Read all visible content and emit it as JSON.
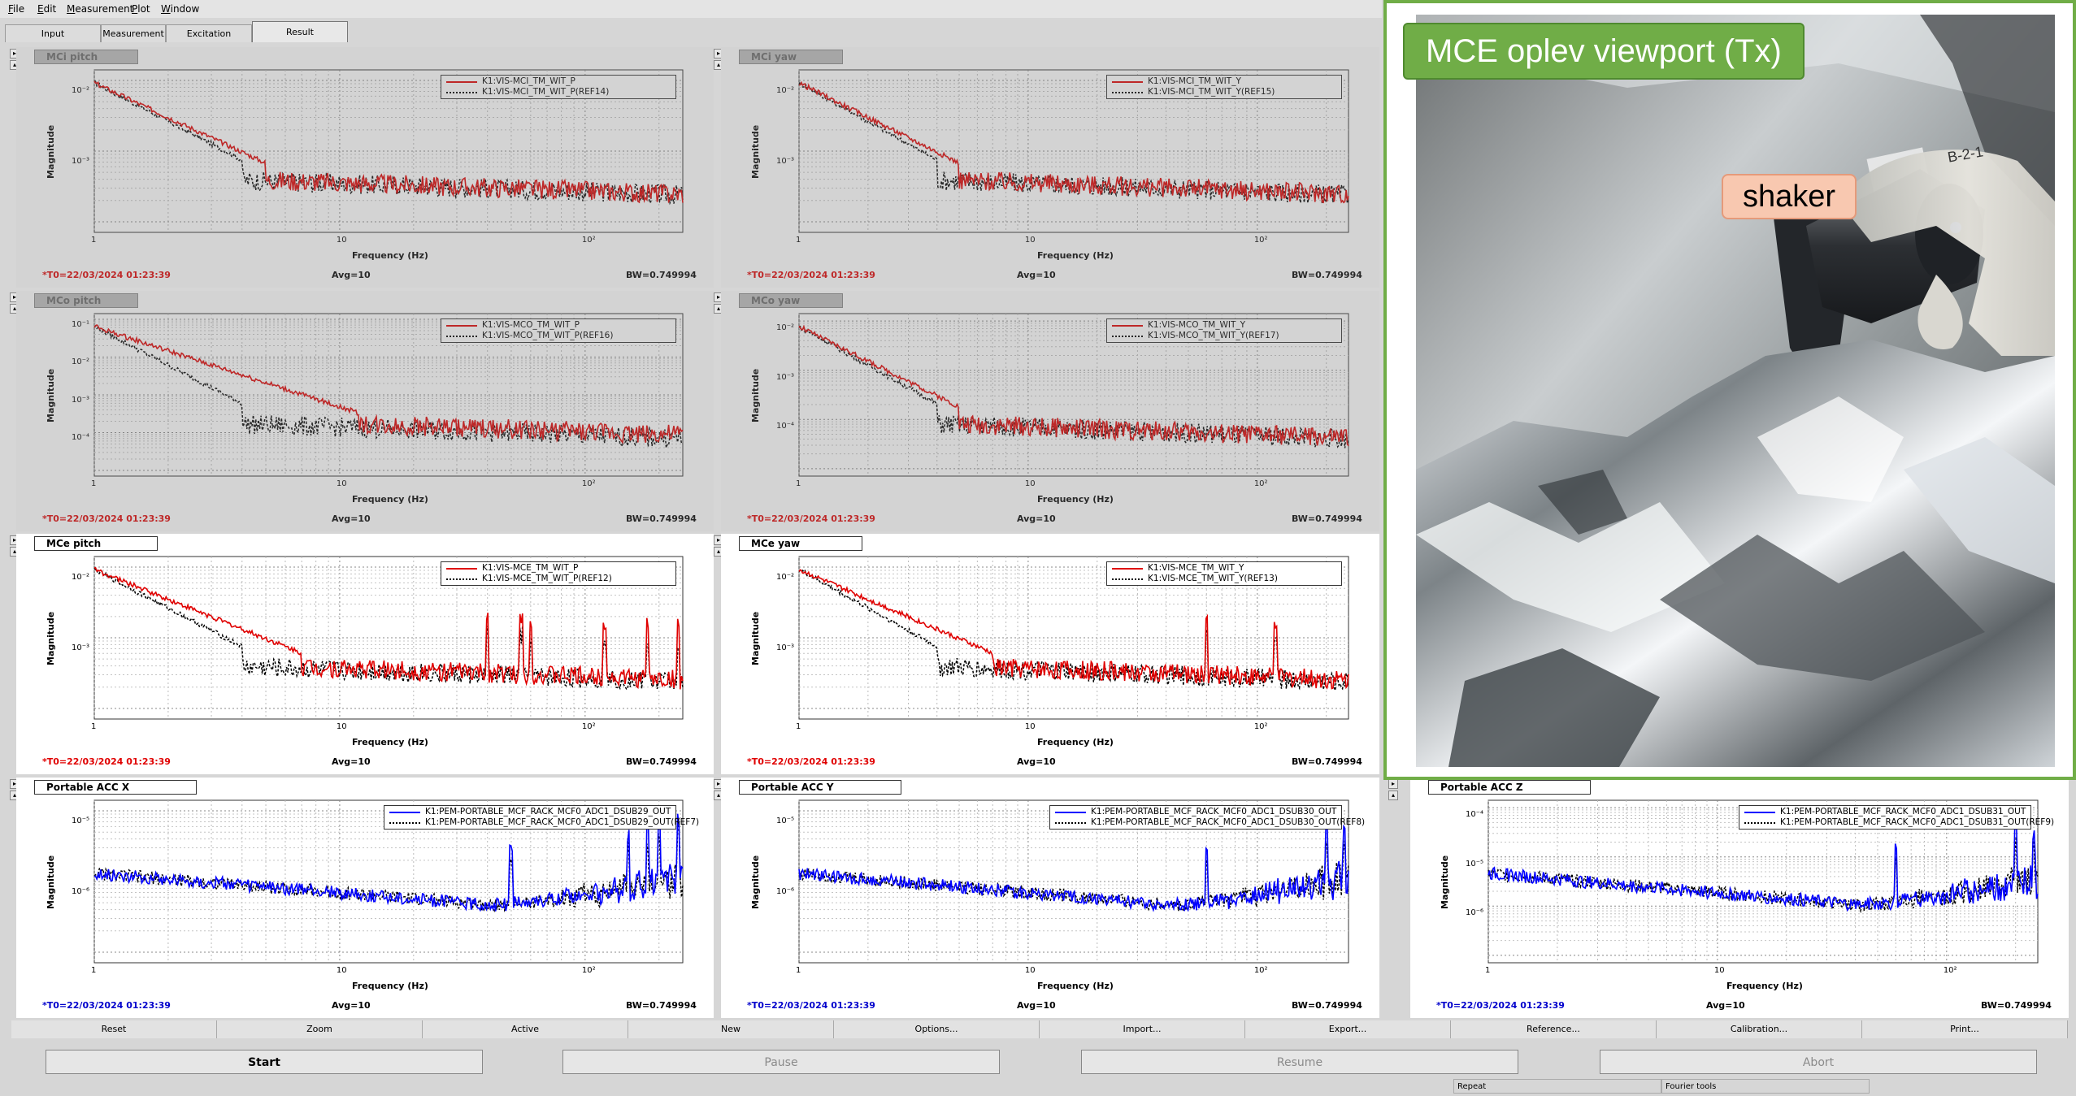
{
  "menubar": {
    "items": [
      {
        "label": "File",
        "hot": "F"
      },
      {
        "label": "Edit",
        "hot": "E"
      },
      {
        "label": "Measurement",
        "hot": "M"
      },
      {
        "label": "Plot",
        "hot": "P"
      },
      {
        "label": "Window",
        "hot": "W"
      }
    ]
  },
  "tabs": [
    "Input",
    "Measurement",
    "Excitation",
    "Result"
  ],
  "active_tab": "Result",
  "panels": [
    {
      "title": "MCi pitch",
      "dim": true,
      "color": "red",
      "legend": [
        "K1:VIS-MCI_TM_WIT_P",
        "K1:VIS-MCI_TM_WIT_P(REF14)"
      ],
      "yticks": [
        "10⁻²",
        "10⁻³"
      ],
      "xticks": [
        "1",
        "10",
        "10²"
      ],
      "xlabel": "Frequency (Hz)",
      "ylabel": "Magnitude",
      "t0": "*T0=22/03/2024 01:23:39",
      "avg": "Avg=10",
      "bw": "BW=0.749994"
    },
    {
      "title": "MCi yaw",
      "dim": true,
      "color": "red",
      "legend": [
        "K1:VIS-MCI_TM_WIT_Y",
        "K1:VIS-MCI_TM_WIT_Y(REF15)"
      ],
      "yticks": [
        "10⁻²",
        "10⁻³"
      ],
      "xticks": [
        "1",
        "10",
        "10²"
      ],
      "xlabel": "Frequency (Hz)",
      "ylabel": "Magnitude",
      "t0": "*T0=22/03/2024 01:23:39",
      "avg": "Avg=10",
      "bw": "BW=0.749994"
    },
    {
      "title": "MCo pitch",
      "dim": true,
      "color": "red",
      "legend": [
        "K1:VIS-MCO_TM_WIT_P",
        "K1:VIS-MCO_TM_WIT_P(REF16)"
      ],
      "yticks": [
        "10⁻¹",
        "10⁻²",
        "10⁻³",
        "10⁻⁴"
      ],
      "xticks": [
        "1",
        "10",
        "10²"
      ],
      "xlabel": "Frequency (Hz)",
      "ylabel": "Magnitude",
      "t0": "*T0=22/03/2024 01:23:39",
      "avg": "Avg=10",
      "bw": "BW=0.749994"
    },
    {
      "title": "MCo yaw",
      "dim": true,
      "color": "red",
      "legend": [
        "K1:VIS-MCO_TM_WIT_Y",
        "K1:VIS-MCO_TM_WIT_Y(REF17)"
      ],
      "yticks": [
        "10⁻²",
        "10⁻³",
        "10⁻⁴"
      ],
      "xticks": [
        "1",
        "10",
        "10²"
      ],
      "xlabel": "Frequency (Hz)",
      "ylabel": "Magnitude",
      "t0": "*T0=22/03/2024 01:23:39",
      "avg": "Avg=10",
      "bw": "BW=0.749994"
    },
    {
      "title": "MCe pitch",
      "dim": false,
      "color": "red",
      "legend": [
        "K1:VIS-MCE_TM_WIT_P",
        "K1:VIS-MCE_TM_WIT_P(REF12)"
      ],
      "yticks": [
        "10⁻²",
        "10⁻³"
      ],
      "xticks": [
        "1",
        "10",
        "10²"
      ],
      "xlabel": "Frequency (Hz)",
      "ylabel": "Magnitude",
      "t0": "*T0=22/03/2024 01:23:39",
      "avg": "Avg=10",
      "bw": "BW=0.749994"
    },
    {
      "title": "MCe yaw",
      "dim": false,
      "color": "red",
      "legend": [
        "K1:VIS-MCE_TM_WIT_Y",
        "K1:VIS-MCE_TM_WIT_Y(REF13)"
      ],
      "yticks": [
        "10⁻²",
        "10⁻³"
      ],
      "xticks": [
        "1",
        "10",
        "10²"
      ],
      "xlabel": "Frequency (Hz)",
      "ylabel": "Magnitude",
      "t0": "*T0=22/03/2024 01:23:39",
      "avg": "Avg=10",
      "bw": "BW=0.749994"
    },
    {
      "title": "Portable ACC X",
      "dim": false,
      "color": "blue",
      "legend": [
        "K1:PEM-PORTABLE_MCF_RACK_MCF0_ADC1_DSUB29_OUT",
        "K1:PEM-PORTABLE_MCF_RACK_MCF0_ADC1_DSUB29_OUT(REF7)"
      ],
      "yticks": [
        "10⁻⁵",
        "10⁻⁶"
      ],
      "xticks": [
        "1",
        "10",
        "10²"
      ],
      "xlabel": "Frequency (Hz)",
      "ylabel": "Magnitude",
      "t0": "*T0=22/03/2024 01:23:39",
      "avg": "Avg=10",
      "bw": "BW=0.749994"
    },
    {
      "title": "Portable ACC Y",
      "dim": false,
      "color": "blue",
      "legend": [
        "K1:PEM-PORTABLE_MCF_RACK_MCF0_ADC1_DSUB30_OUT",
        "K1:PEM-PORTABLE_MCF_RACK_MCF0_ADC1_DSUB30_OUT(REF8)"
      ],
      "yticks": [
        "10⁻⁵",
        "10⁻⁶"
      ],
      "xticks": [
        "1",
        "10",
        "10²"
      ],
      "xlabel": "Frequency (Hz)",
      "ylabel": "Magnitude",
      "t0": "*T0=22/03/2024 01:23:39",
      "avg": "Avg=10",
      "bw": "BW=0.749994"
    },
    {
      "title": "Portable ACC Z",
      "dim": false,
      "color": "blue",
      "legend": [
        "K1:PEM-PORTABLE_MCF_RACK_MCF0_ADC1_DSUB31_OUT",
        "K1:PEM-PORTABLE_MCF_RACK_MCF0_ADC1_DSUB31_OUT(REF9)"
      ],
      "yticks": [
        "10⁻⁴",
        "10⁻⁵",
        "10⁻⁶"
      ],
      "xticks": [
        "1",
        "10",
        "10²"
      ],
      "xlabel": "Frequency (Hz)",
      "ylabel": "Magnitude",
      "t0": "*T0=22/03/2024 01:23:39",
      "avg": "Avg=10",
      "bw": "BW=0.749994"
    }
  ],
  "toolbar": [
    "Reset",
    "Zoom",
    "Active",
    "New",
    "Options...",
    "Import...",
    "Export...",
    "Reference...",
    "Calibration...",
    "Print..."
  ],
  "actions": [
    {
      "label": "Start",
      "enabled": true
    },
    {
      "label": "Pause",
      "enabled": false
    },
    {
      "label": "Resume",
      "enabled": false
    },
    {
      "label": "Abort",
      "enabled": false
    }
  ],
  "status": [
    "Repeat",
    "Fourier tools"
  ],
  "photo": {
    "title": "MCE oplev viewport (Tx)",
    "callout": "shaker",
    "tag": "B-2-1"
  },
  "colors": {
    "data_red": "#e00000",
    "data_blue": "#0000ff",
    "frame_green": "#70ad47",
    "callout_bg": "#f8c8b0"
  }
}
